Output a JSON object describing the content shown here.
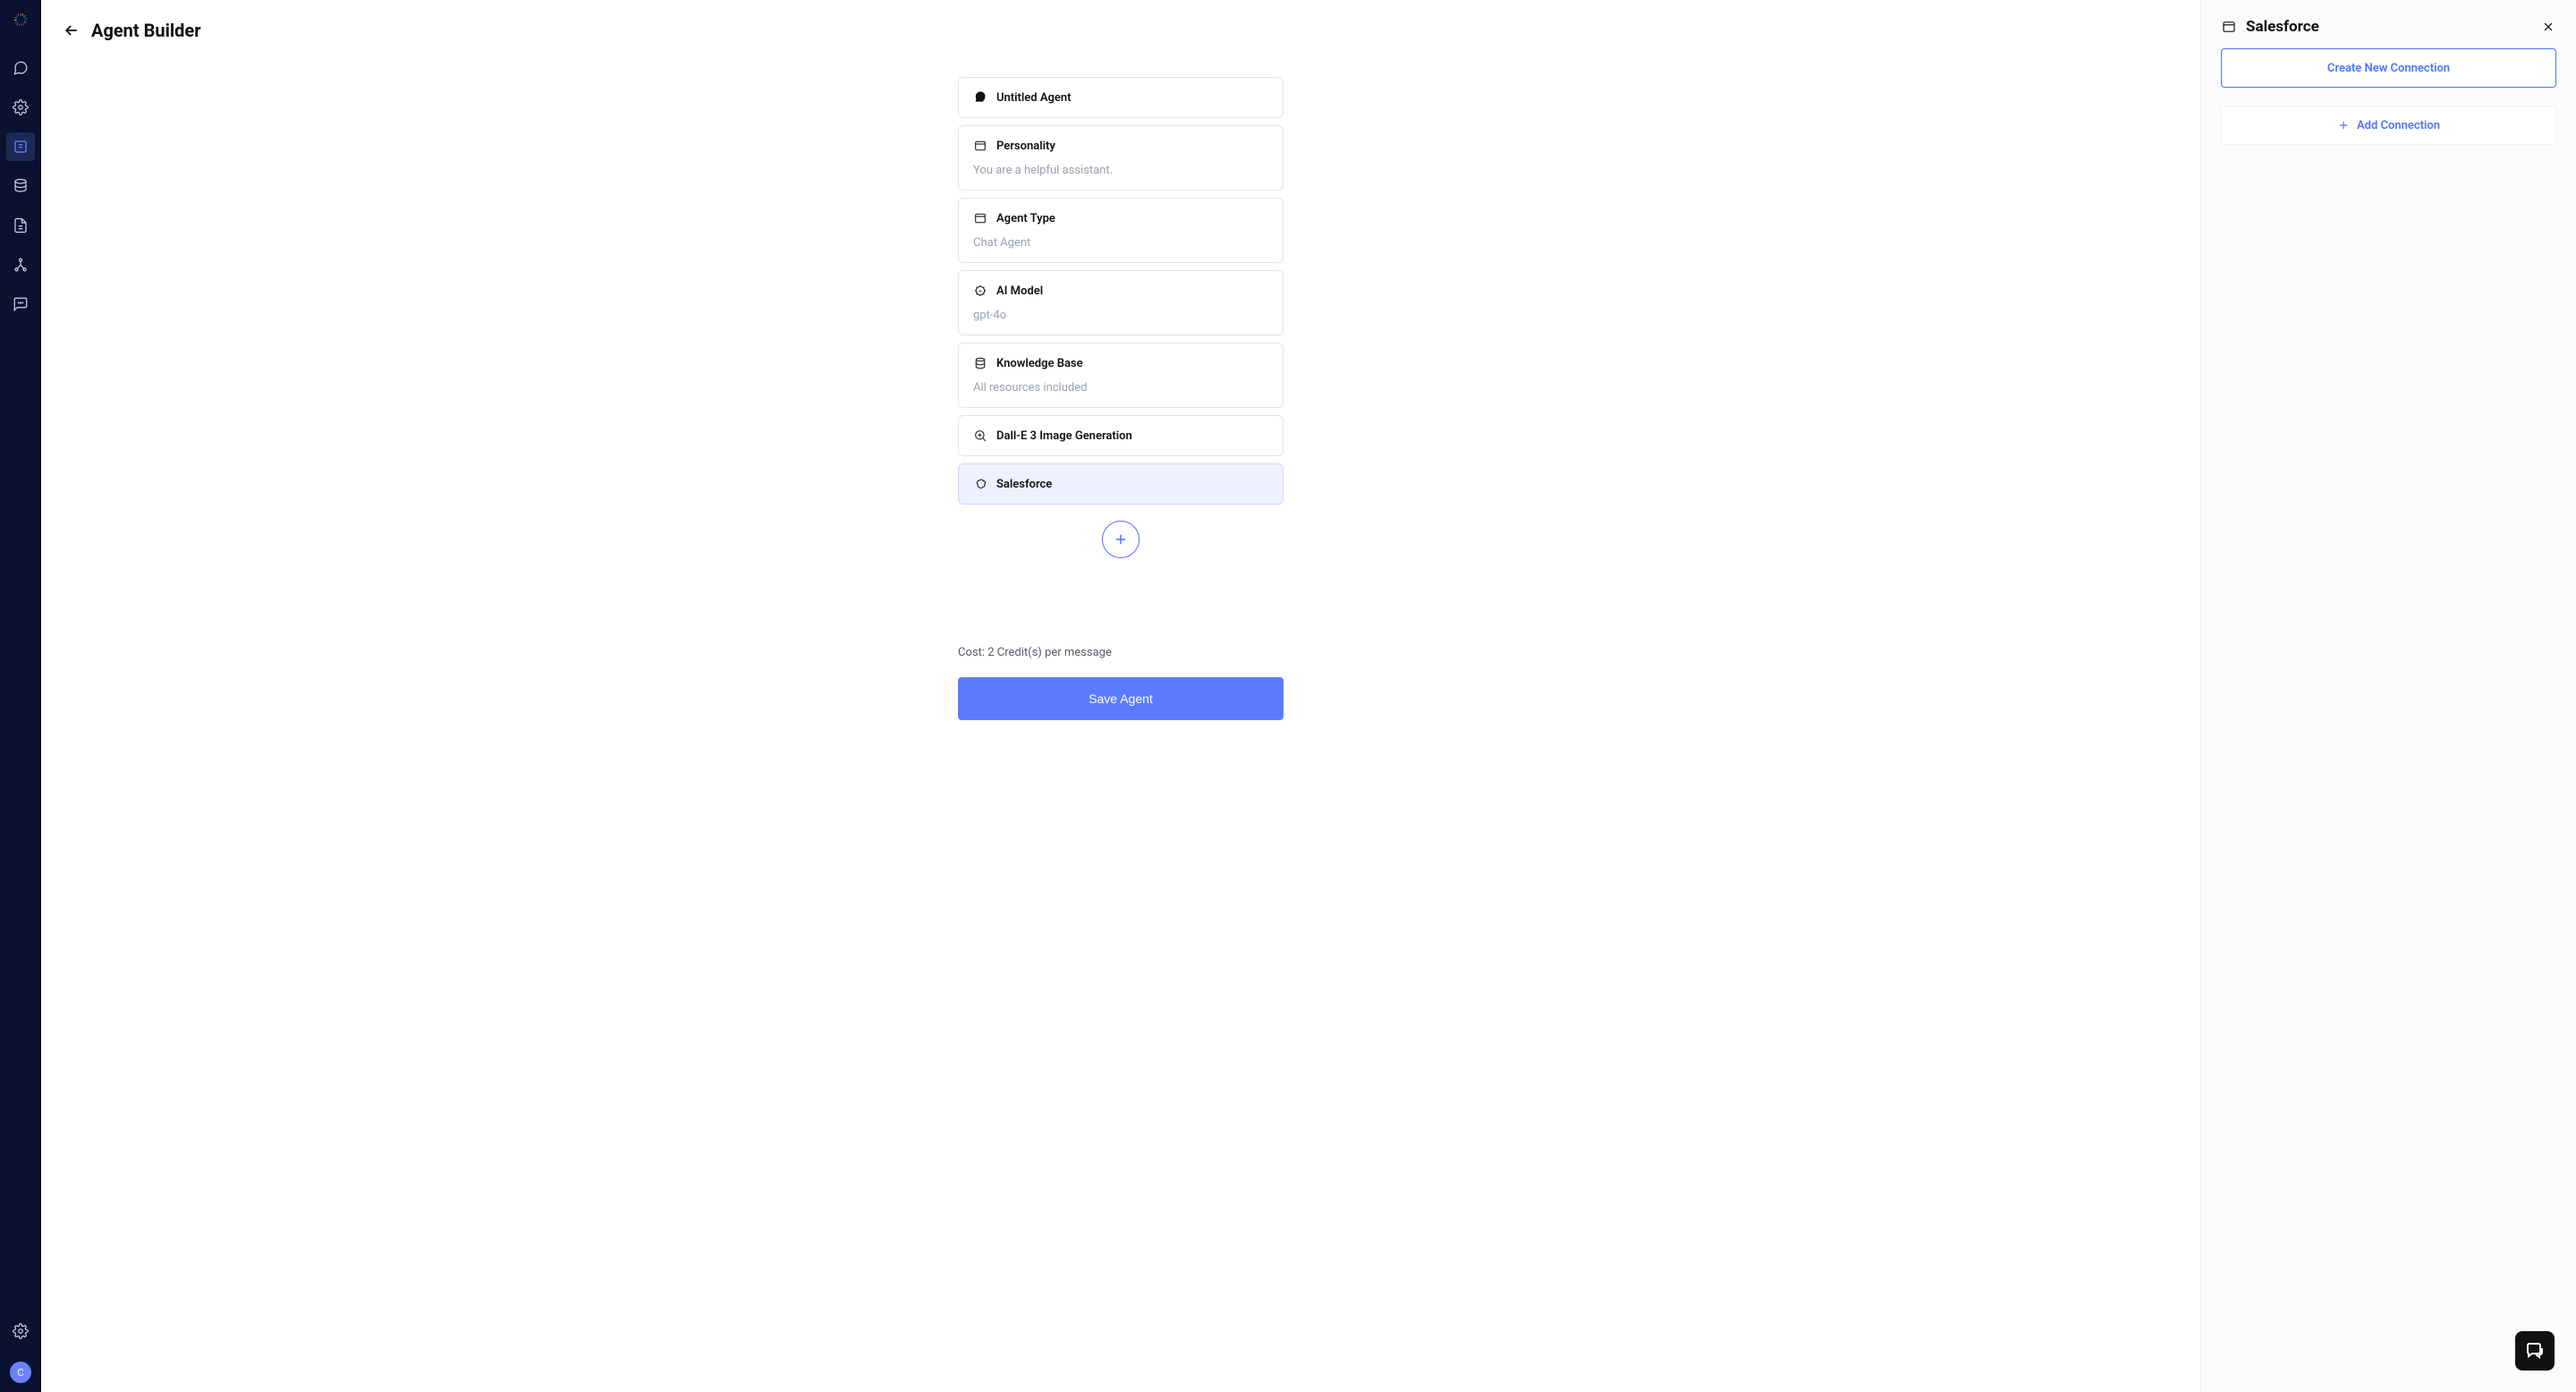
{
  "sidebar": {
    "avatar_letter": "C"
  },
  "header": {
    "title": "Agent Builder"
  },
  "cards": {
    "agent_name": "Untitled Agent",
    "personality_label": "Personality",
    "personality_value": "You are a helpful assistant.",
    "agent_type_label": "Agent Type",
    "agent_type_value": "Chat Agent",
    "ai_model_label": "AI Model",
    "ai_model_value": "gpt-4o",
    "kb_label": "Knowledge Base",
    "kb_value": "All resources included",
    "dalle_label": "Dall-E 3 Image Generation",
    "salesforce_label": "Salesforce"
  },
  "footer": {
    "cost_text": "Cost: 2 Credit(s) per message",
    "save_label": "Save Agent"
  },
  "panel": {
    "title": "Salesforce",
    "create_label": "Create New Connection",
    "add_label": "Add Connection"
  }
}
